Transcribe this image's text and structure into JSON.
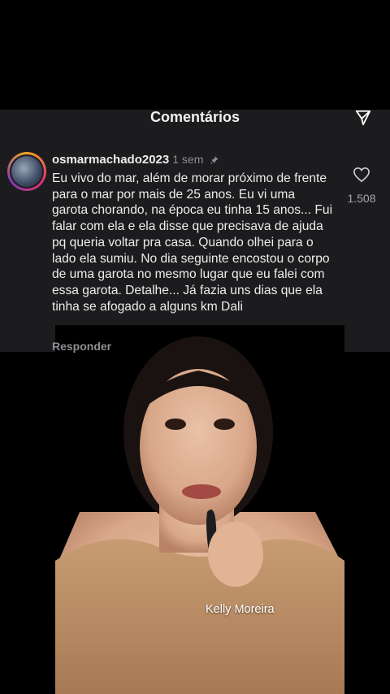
{
  "panel": {
    "title": "Comentários"
  },
  "comment": {
    "username": "osmarmachado2023",
    "time": "1 sem",
    "text": "Eu vivo do mar, além de morar próximo de frente para o mar por mais de 25 anos. Eu vi uma garota chorando, na época eu tinha 15 anos... Fui falar com ela e ela disse que precisava de ajuda pq queria voltar pra casa. Quando olhei para o lado ela sumiu. No dia seguinte encostou o corpo de uma garota no mesmo lugar que eu falei com essa garota. Detalhe... Já fazia uns dias que ela tinha se afogado a alguns km Dali",
    "likes": "1.508",
    "reply_label": "Responder",
    "icons": {
      "like": "heart-icon",
      "pinned": "pin-icon"
    }
  },
  "header": {
    "share_icon": "send-icon"
  },
  "video": {
    "caption": "Kelly Moreira"
  }
}
